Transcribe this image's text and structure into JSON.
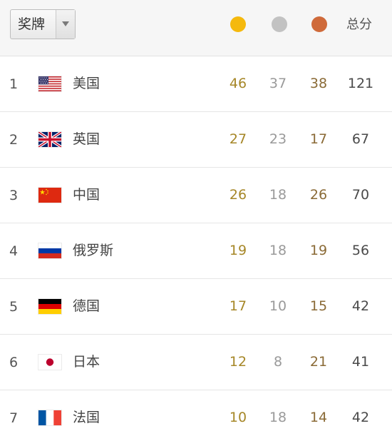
{
  "header": {
    "dropdown_label": "奖牌",
    "total_label": "总分",
    "medal_icons": [
      {
        "name": "gold-medal-icon",
        "color": "#f5b90d"
      },
      {
        "name": "silver-medal-icon",
        "color": "#c2c2c2"
      },
      {
        "name": "bronze-medal-icon",
        "color": "#cf6a3a"
      }
    ]
  },
  "rows": [
    {
      "rank": "1",
      "flag": "usa-flag-icon",
      "country": "美国",
      "gold": "46",
      "silver": "37",
      "bronze": "38",
      "total": "121"
    },
    {
      "rank": "2",
      "flag": "uk-flag-icon",
      "country": "英国",
      "gold": "27",
      "silver": "23",
      "bronze": "17",
      "total": "67"
    },
    {
      "rank": "3",
      "flag": "china-flag-icon",
      "country": "中国",
      "gold": "26",
      "silver": "18",
      "bronze": "26",
      "total": "70"
    },
    {
      "rank": "4",
      "flag": "russia-flag-icon",
      "country": "俄罗斯",
      "gold": "19",
      "silver": "18",
      "bronze": "19",
      "total": "56"
    },
    {
      "rank": "5",
      "flag": "germany-flag-icon",
      "country": "德国",
      "gold": "17",
      "silver": "10",
      "bronze": "15",
      "total": "42"
    },
    {
      "rank": "6",
      "flag": "japan-flag-icon",
      "country": "日本",
      "gold": "12",
      "silver": "8",
      "bronze": "21",
      "total": "41"
    },
    {
      "rank": "7",
      "flag": "france-flag-icon",
      "country": "法国",
      "gold": "10",
      "silver": "18",
      "bronze": "14",
      "total": "42"
    }
  ]
}
